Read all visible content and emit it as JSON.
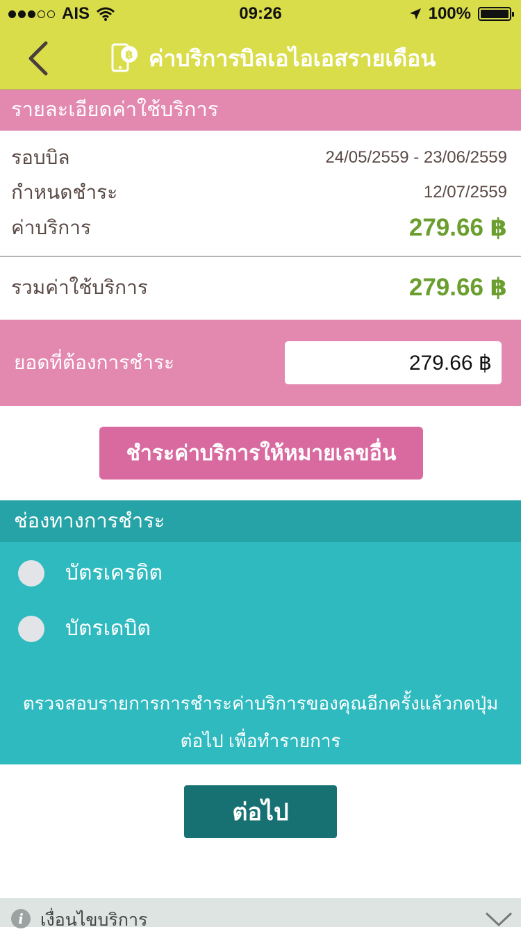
{
  "status_bar": {
    "carrier": "AIS",
    "time": "09:26",
    "battery": "100%"
  },
  "header": {
    "title": "ค่าบริการบิลเอไอเอสรายเดือน",
    "color": "#d9dd4a"
  },
  "details": {
    "section_title": "รายละเอียดค่าใช้บริการ",
    "bill_cycle_label": "รอบบิล",
    "bill_cycle_value": "24/05/2559 - 23/06/2559",
    "due_label": "กำหนดชำระ",
    "due_value": "12/07/2559",
    "service_label": "ค่าบริการ",
    "service_value": "279.66 ฿",
    "total_label": "รวมค่าใช้บริการ",
    "total_value": "279.66 ฿"
  },
  "payment": {
    "amount_label": "ยอดที่ต้องการชำระ",
    "amount_value": "279.66 ฿"
  },
  "pay_other_button": "ชำระค่าบริการให้หมายเลขอื่น",
  "channels": {
    "title": "ช่องทางการชำระ",
    "options": [
      "บัตรเครดิต",
      "บัตรเดบิต"
    ],
    "note_line1": "ตรวจสอบรายการการชำระค่าบริการของคุณอีกครั้งแล้วกดปุ่ม",
    "note_line2": "ต่อไป เพื่อทำรายการ"
  },
  "next_button": "ต่อไป",
  "footer": {
    "label": "เงื่อนไขบริการ"
  }
}
